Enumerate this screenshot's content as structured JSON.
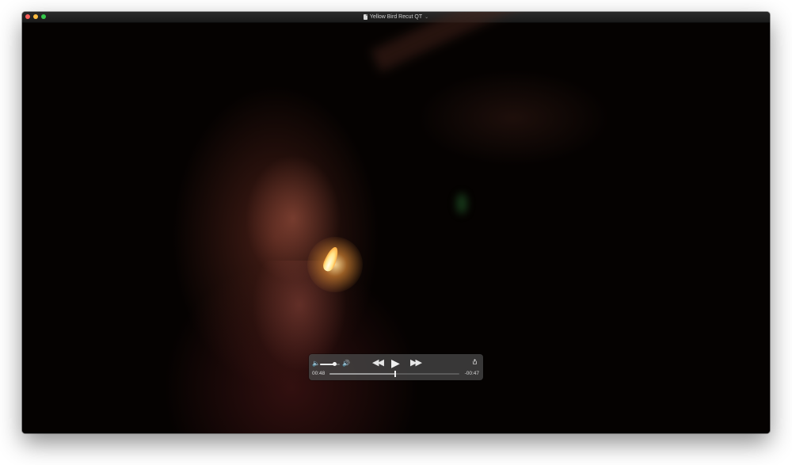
{
  "window": {
    "title": "Yellow Bird Recut QT",
    "title_icon": "document-icon",
    "title_menu_icon": "chevron-down-icon"
  },
  "controls": {
    "volume_level": 0.75,
    "current_time": "00:48",
    "remaining_time": "-00:47",
    "playback_progress": 0.505,
    "icons": {
      "volume_low": "speaker-low-icon",
      "volume_high": "speaker-high-icon",
      "rewind": "rewind-icon",
      "play": "play-icon",
      "fast_forward": "fast-forward-icon",
      "share": "share-icon"
    }
  },
  "colors": {
    "close": "#fc605c",
    "minimize": "#fdbc40",
    "zoom": "#34c84a",
    "hud_bg": "#464646"
  }
}
